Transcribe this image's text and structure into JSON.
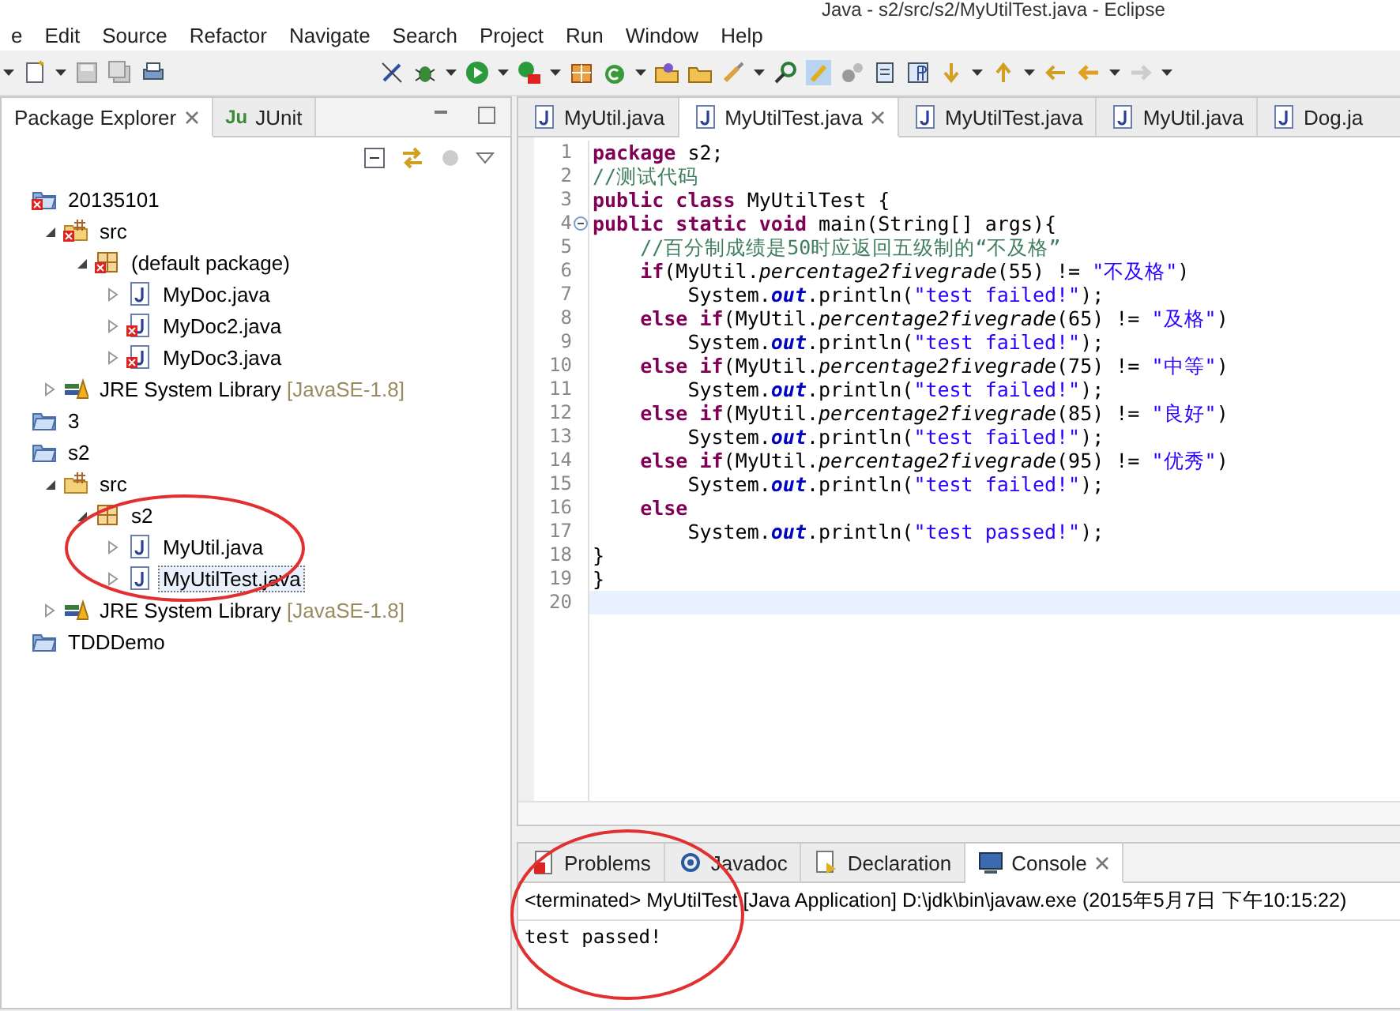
{
  "window": {
    "title": "Java - s2/src/s2/MyUtilTest.java - Eclipse"
  },
  "menu": [
    "e",
    "Edit",
    "Source",
    "Refactor",
    "Navigate",
    "Search",
    "Project",
    "Run",
    "Window",
    "Help"
  ],
  "explorer": {
    "tabs": [
      {
        "label": "Package Explorer",
        "selected": true
      },
      {
        "label": "JUnit",
        "icon_text": "Ju",
        "selected": false
      }
    ],
    "tree": [
      {
        "kind": "project",
        "label": "20135101",
        "error": true,
        "selected": false,
        "children": [
          {
            "kind": "source-folder",
            "label": "src",
            "error": true,
            "expanded": true,
            "selected": false,
            "children": [
              {
                "kind": "package",
                "label": "(default package)",
                "error": true,
                "expanded": true,
                "selected": false,
                "children": [
                  {
                    "kind": "java-file",
                    "label": "MyDoc.java",
                    "error": false,
                    "expanded": false,
                    "selected": false
                  },
                  {
                    "kind": "java-file",
                    "label": "MyDoc2.java",
                    "error": true,
                    "expanded": false,
                    "selected": false
                  },
                  {
                    "kind": "java-file",
                    "label": "MyDoc3.java",
                    "error": true,
                    "expanded": false,
                    "selected": false
                  }
                ]
              }
            ]
          },
          {
            "kind": "library",
            "label": "JRE System Library",
            "qualifier": "[JavaSE-1.8]",
            "error": false,
            "expanded": false,
            "selected": false
          }
        ]
      },
      {
        "kind": "project",
        "label": "3",
        "error": false,
        "selected": false
      },
      {
        "kind": "project",
        "label": "s2",
        "error": false,
        "selected": false,
        "children": [
          {
            "kind": "source-folder",
            "label": "src",
            "error": false,
            "expanded": true,
            "selected": false,
            "children": [
              {
                "kind": "package",
                "label": "s2",
                "error": false,
                "expanded": true,
                "selected": false,
                "children": [
                  {
                    "kind": "java-file",
                    "label": "MyUtil.java",
                    "error": false,
                    "expanded": false,
                    "selected": false
                  },
                  {
                    "kind": "java-file",
                    "label": "MyUtilTest.java",
                    "error": false,
                    "expanded": false,
                    "selected": true
                  }
                ]
              }
            ]
          },
          {
            "kind": "library",
            "label": "JRE System Library",
            "qualifier": "[JavaSE-1.8]",
            "error": false,
            "expanded": false,
            "selected": false
          }
        ]
      },
      {
        "kind": "project",
        "label": "TDDDemo",
        "error": false,
        "selected": false
      }
    ]
  },
  "editor": {
    "tabs": [
      {
        "label": "MyUtil.java",
        "selected": false
      },
      {
        "label": "MyUtilTest.java",
        "selected": true
      },
      {
        "label": "MyUtilTest.java",
        "selected": false
      },
      {
        "label": "MyUtil.java",
        "selected": false
      },
      {
        "label": "Dog.ja",
        "selected": false
      }
    ],
    "lines": [
      {
        "n": "1",
        "current": false,
        "tokens": [
          {
            "kind": "kw",
            "text": "package"
          },
          {
            "kind": "p",
            "text": " s2;"
          }
        ]
      },
      {
        "n": "2",
        "current": false,
        "tokens": [
          {
            "kind": "cm",
            "text": "//测试代码"
          }
        ]
      },
      {
        "n": "3",
        "current": false,
        "tokens": [
          {
            "kind": "kw",
            "text": "public"
          },
          {
            "kind": "kw",
            "text": " class"
          },
          {
            "kind": "p",
            "text": " MyUtilTest {"
          }
        ]
      },
      {
        "n": "4",
        "current": false,
        "tokens": [
          {
            "kind": "kw",
            "text": "public"
          },
          {
            "kind": "kw",
            "text": " static"
          },
          {
            "kind": "kw",
            "text": " void"
          },
          {
            "kind": "p",
            "text": " main(String[] args){"
          }
        ]
      },
      {
        "n": "5",
        "current": false,
        "tokens": [
          {
            "kind": "cm",
            "text": "    //百分制成绩是50时应返回五级制的“不及格”"
          }
        ]
      },
      {
        "n": "6",
        "current": false,
        "tokens": [
          {
            "kind": "kw",
            "text": "    if"
          },
          {
            "kind": "p",
            "text": "(MyUtil."
          },
          {
            "kind": "it",
            "text": "percentage2fivegrade"
          },
          {
            "kind": "p",
            "text": "(55) != "
          },
          {
            "kind": "str",
            "text": "\"不及格\""
          },
          {
            "kind": "p",
            "text": ")"
          }
        ]
      },
      {
        "n": "7",
        "current": false,
        "tokens": [
          {
            "kind": "p",
            "text": "        System."
          },
          {
            "kind": "fld",
            "text": "out"
          },
          {
            "kind": "p",
            "text": ".println("
          },
          {
            "kind": "str",
            "text": "\"test failed!\""
          },
          {
            "kind": "p",
            "text": ");"
          }
        ]
      },
      {
        "n": "8",
        "current": false,
        "tokens": [
          {
            "kind": "kw",
            "text": "    else"
          },
          {
            "kind": "kw",
            "text": " if"
          },
          {
            "kind": "p",
            "text": "(MyUtil."
          },
          {
            "kind": "it",
            "text": "percentage2fivegrade"
          },
          {
            "kind": "p",
            "text": "(65) != "
          },
          {
            "kind": "str",
            "text": "\"及格\""
          },
          {
            "kind": "p",
            "text": ")"
          }
        ]
      },
      {
        "n": "9",
        "current": false,
        "tokens": [
          {
            "kind": "p",
            "text": "        System."
          },
          {
            "kind": "fld",
            "text": "out"
          },
          {
            "kind": "p",
            "text": ".println("
          },
          {
            "kind": "str",
            "text": "\"test failed!\""
          },
          {
            "kind": "p",
            "text": ");"
          }
        ]
      },
      {
        "n": "10",
        "current": false,
        "tokens": [
          {
            "kind": "kw",
            "text": "    else"
          },
          {
            "kind": "kw",
            "text": " if"
          },
          {
            "kind": "p",
            "text": "(MyUtil."
          },
          {
            "kind": "it",
            "text": "percentage2fivegrade"
          },
          {
            "kind": "p",
            "text": "(75) != "
          },
          {
            "kind": "str",
            "text": "\"中等\""
          },
          {
            "kind": "p",
            "text": ")"
          }
        ]
      },
      {
        "n": "11",
        "current": false,
        "tokens": [
          {
            "kind": "p",
            "text": "        System."
          },
          {
            "kind": "fld",
            "text": "out"
          },
          {
            "kind": "p",
            "text": ".println("
          },
          {
            "kind": "str",
            "text": "\"test failed!\""
          },
          {
            "kind": "p",
            "text": ");"
          }
        ]
      },
      {
        "n": "12",
        "current": false,
        "tokens": [
          {
            "kind": "kw",
            "text": "    else"
          },
          {
            "kind": "kw",
            "text": " if"
          },
          {
            "kind": "p",
            "text": "(MyUtil."
          },
          {
            "kind": "it",
            "text": "percentage2fivegrade"
          },
          {
            "kind": "p",
            "text": "(85) != "
          },
          {
            "kind": "str",
            "text": "\"良好\""
          },
          {
            "kind": "p",
            "text": ")"
          }
        ]
      },
      {
        "n": "13",
        "current": false,
        "tokens": [
          {
            "kind": "p",
            "text": "        System."
          },
          {
            "kind": "fld",
            "text": "out"
          },
          {
            "kind": "p",
            "text": ".println("
          },
          {
            "kind": "str",
            "text": "\"test failed!\""
          },
          {
            "kind": "p",
            "text": ");"
          }
        ]
      },
      {
        "n": "14",
        "current": false,
        "tokens": [
          {
            "kind": "kw",
            "text": "    else"
          },
          {
            "kind": "kw",
            "text": " if"
          },
          {
            "kind": "p",
            "text": "(MyUtil."
          },
          {
            "kind": "it",
            "text": "percentage2fivegrade"
          },
          {
            "kind": "p",
            "text": "(95) != "
          },
          {
            "kind": "str",
            "text": "\"优秀\""
          },
          {
            "kind": "p",
            "text": ")"
          }
        ]
      },
      {
        "n": "15",
        "current": false,
        "tokens": [
          {
            "kind": "p",
            "text": "        System."
          },
          {
            "kind": "fld",
            "text": "out"
          },
          {
            "kind": "p",
            "text": ".println("
          },
          {
            "kind": "str",
            "text": "\"test failed!\""
          },
          {
            "kind": "p",
            "text": ");"
          }
        ]
      },
      {
        "n": "16",
        "current": false,
        "tokens": [
          {
            "kind": "kw",
            "text": "    else"
          }
        ]
      },
      {
        "n": "17",
        "current": false,
        "tokens": [
          {
            "kind": "p",
            "text": "        System."
          },
          {
            "kind": "fld",
            "text": "out"
          },
          {
            "kind": "p",
            "text": ".println("
          },
          {
            "kind": "str",
            "text": "\"test passed!\""
          },
          {
            "kind": "p",
            "text": ");"
          }
        ]
      },
      {
        "n": "18",
        "current": false,
        "tokens": [
          {
            "kind": "p",
            "text": "}"
          }
        ]
      },
      {
        "n": "19",
        "current": false,
        "tokens": [
          {
            "kind": "p",
            "text": "}"
          }
        ]
      },
      {
        "n": "20",
        "current": true
      }
    ]
  },
  "bottom": {
    "tabs": [
      {
        "label": "Problems",
        "selected": false
      },
      {
        "label": "Javadoc",
        "selected": false
      },
      {
        "label": "Declaration",
        "selected": false
      },
      {
        "label": "Console",
        "selected": true
      }
    ],
    "console_header": "<terminated> MyUtilTest [Java Application] D:\\jdk\\bin\\javaw.exe (2015年5月7日 下午10:15:22)",
    "output": "test passed!"
  }
}
